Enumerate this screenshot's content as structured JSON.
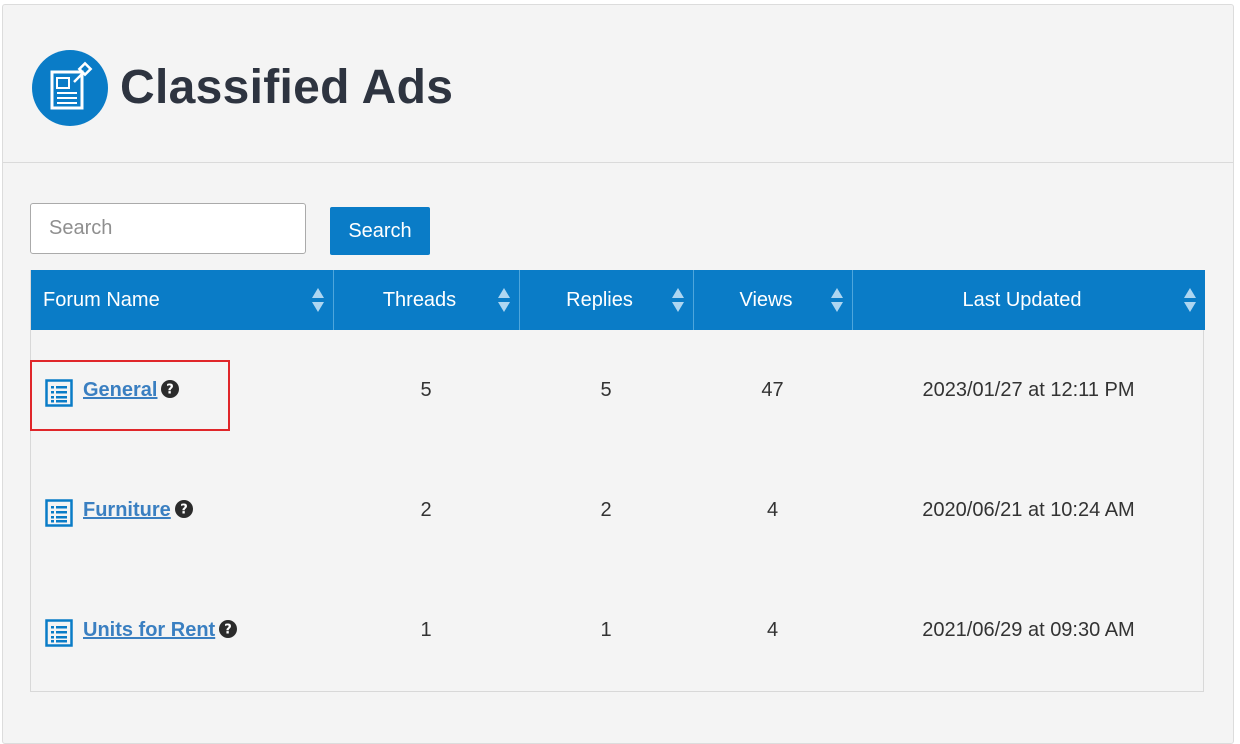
{
  "page": {
    "title": "Classified Ads",
    "logo_icon": "classified-ads-document-icon"
  },
  "search": {
    "placeholder": "Search",
    "value": "",
    "button_label": "Search"
  },
  "table": {
    "columns": [
      "Forum Name",
      "Threads",
      "Replies",
      "Views",
      "Last Updated"
    ],
    "rows": [
      {
        "name": "General",
        "threads": "5",
        "replies": "5",
        "views": "47",
        "last_updated": "2023/01/27 at 12:11 PM",
        "highlighted": true
      },
      {
        "name": "Furniture",
        "threads": "2",
        "replies": "2",
        "views": "4",
        "last_updated": "2020/06/21 at 10:24 AM",
        "highlighted": false
      },
      {
        "name": "Units for Rent",
        "threads": "1",
        "replies": "1",
        "views": "4",
        "last_updated": "2021/06/29 at 09:30 AM",
        "highlighted": false
      }
    ]
  },
  "colors": {
    "accent": "#0a7cc7",
    "link": "#3a7fc1",
    "highlight_box": "#e0262a",
    "panel_bg": "#f4f4f4",
    "title_text": "#2e3440"
  }
}
